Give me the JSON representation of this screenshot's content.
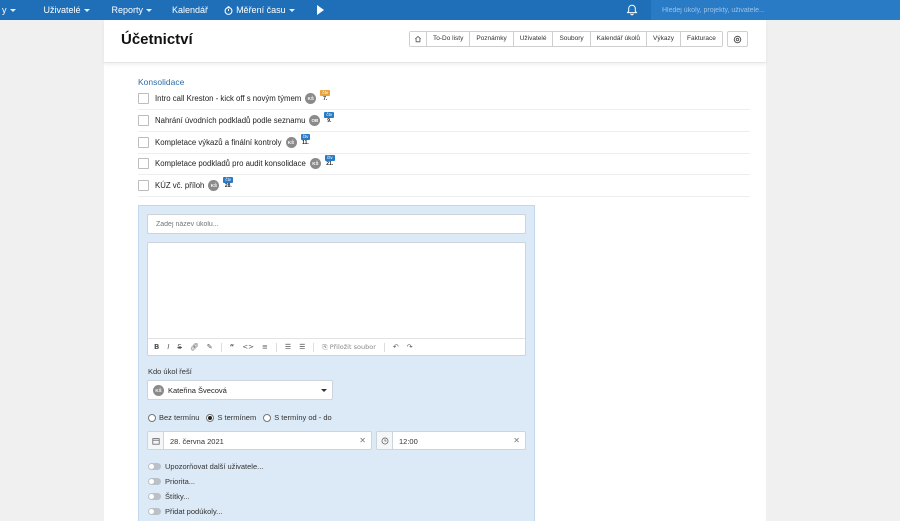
{
  "nav": {
    "items": [
      {
        "label": "y",
        "caret": true
      },
      {
        "label": "Uživatelé",
        "caret": true
      },
      {
        "label": "Reporty",
        "caret": true
      },
      {
        "label": "Kalendář",
        "caret": false
      },
      {
        "label": "Měření času",
        "caret": true
      }
    ],
    "search_placeholder": "Hledej úkoly, projekty, uživatele..."
  },
  "header": {
    "title": "Účetnictví",
    "tabs": [
      "To-Do listy",
      "Poznámky",
      "Uživatelé",
      "Soubory",
      "Kalendář úkolů",
      "Výkazy",
      "Fakturace"
    ]
  },
  "list": {
    "title": "Konsolidace",
    "tasks": [
      {
        "text": "Intro call Kreston - kick off s novým týmem",
        "avatar": "KŠ",
        "date_day": "čtv",
        "date_num": "7.",
        "date_color": "#e8a33a"
      },
      {
        "text": "Nahrání úvodních podkladů podle seznamu",
        "avatar": "OB",
        "date_day": "čtv",
        "date_num": "9.",
        "date_color": "#2a7bc6"
      },
      {
        "text": "Kompletace výkazů a finální kontroly",
        "avatar": "KŠ",
        "date_day": "čtv",
        "date_num": "11.",
        "date_color": "#2a7bc6"
      },
      {
        "text": "Kompletace podkladů pro audit konsolidace",
        "avatar": "KŠ",
        "date_day": "čtv",
        "date_num": "21.",
        "date_color": "#2a7bc6"
      },
      {
        "text": "KÚZ vč. příloh",
        "avatar": "KŠ",
        "date_day": "čtv",
        "date_num": "28.",
        "date_color": "#2a7bc6"
      }
    ]
  },
  "form": {
    "task_name_placeholder": "Zadej název úkolu...",
    "toolbar": {
      "bold": "B",
      "italic": "I",
      "strike": "S",
      "attach_label": "Přiložit soubor"
    },
    "assignee_label": "Kdo úkol řeší",
    "assignee_avatar": "KŠ",
    "assignee_value": "Kateřina Švecová",
    "deadline_options": [
      {
        "label": "Bez termínu",
        "selected": false
      },
      {
        "label": "S termínem",
        "selected": true
      },
      {
        "label": "S termíny od - do",
        "selected": false
      }
    ],
    "date_value": "28. června 2021",
    "time_value": "12:00",
    "toggles": [
      "Upozorňovat další uživatele...",
      "Priorita...",
      "Štítky...",
      "Přidat podúkoly..."
    ]
  }
}
